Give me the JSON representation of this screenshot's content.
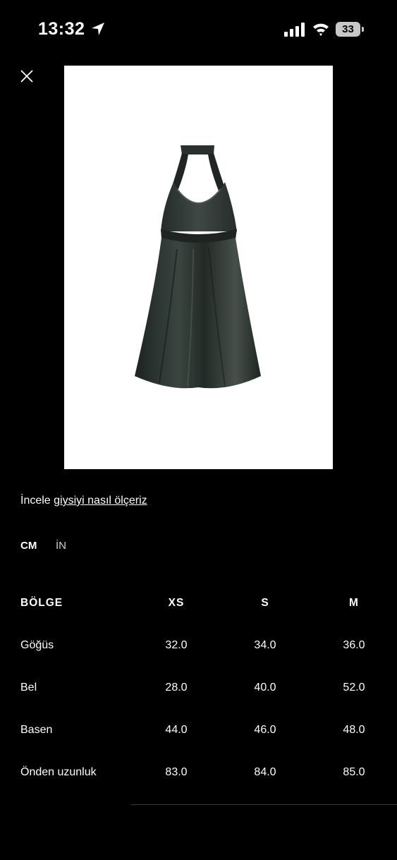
{
  "status_bar": {
    "time": "13:32",
    "battery": "33"
  },
  "measure_text": {
    "prefix": "İncele ",
    "link": "giysiyi nasıl ölçeriz"
  },
  "units": {
    "cm": "CM",
    "in": "İN"
  },
  "table": {
    "headers": [
      "BÖLGE",
      "XS",
      "S",
      "M"
    ],
    "rows": [
      {
        "label": "Göğüs",
        "values": [
          "32.0",
          "34.0",
          "36.0"
        ]
      },
      {
        "label": "Bel",
        "values": [
          "28.0",
          "40.0",
          "52.0"
        ]
      },
      {
        "label": "Basen",
        "values": [
          "44.0",
          "46.0",
          "48.0"
        ]
      },
      {
        "label": "Önden uzunluk",
        "values": [
          "83.0",
          "84.0",
          "85.0"
        ]
      }
    ]
  },
  "icons": [
    "location-arrow-icon",
    "signal-icon",
    "wifi-icon",
    "close-icon"
  ]
}
